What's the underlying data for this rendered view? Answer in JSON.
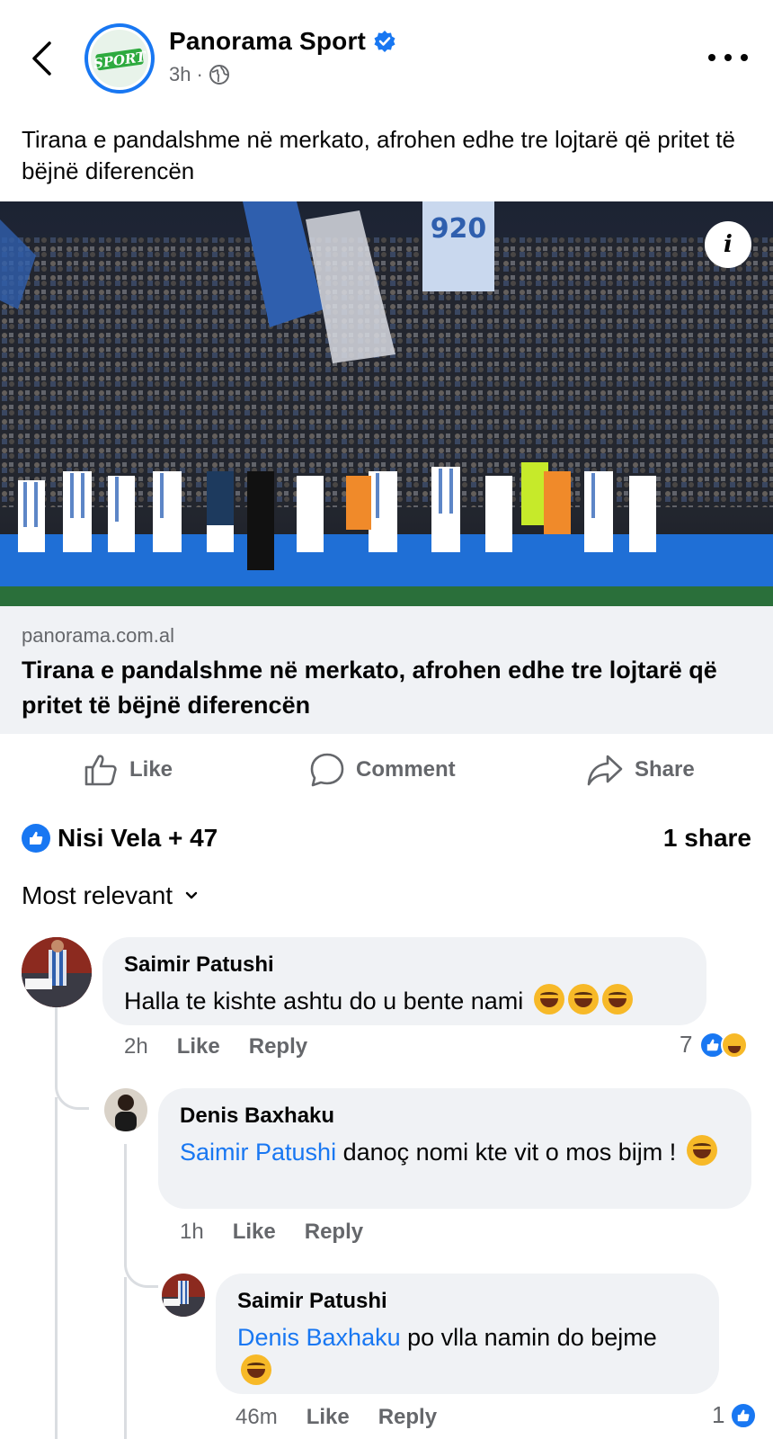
{
  "post": {
    "page_name": "Panorama Sport",
    "time": "3h",
    "separator": "·",
    "audience_icon": "globe-icon",
    "text": "Tirana e pandalshme në merkato, afrohen edhe tre lojtarë që pritet të bëjnë diferencën",
    "avatar_text": "SPORT"
  },
  "link": {
    "domain": "panorama.com.al",
    "title": "Tirana e pandalshme në merkato, afrohen edhe tre lojtarë që pritet të bëjnë diferencën"
  },
  "actions": {
    "like": "Like",
    "comment": "Comment",
    "share": "Share"
  },
  "summary": {
    "reactors": "Nisi Vela + 47",
    "shares": "1 share"
  },
  "sort_label": "Most relevant",
  "comments": [
    {
      "author": "Saimir Patushi",
      "text": "Halla te kishte ashtu do u bente nami",
      "time": "2h",
      "like_label": "Like",
      "reply_label": "Reply",
      "reaction_count": "7"
    },
    {
      "author": "Denis Baxhaku",
      "mention": "Saimir Patushi",
      "text": " danoç nomi kte vit o mos bijm !",
      "time": "1h",
      "like_label": "Like",
      "reply_label": "Reply"
    },
    {
      "author": "Saimir Patushi",
      "mention": "Denis Baxhaku",
      "text": " po vlla namin do bejme",
      "time": "46m",
      "like_label": "Like",
      "reply_label": "Reply",
      "reaction_count": "1"
    }
  ],
  "colors": {
    "accent": "#1877f2",
    "secondary_text": "#65676b",
    "bubble": "#f0f2f5"
  }
}
